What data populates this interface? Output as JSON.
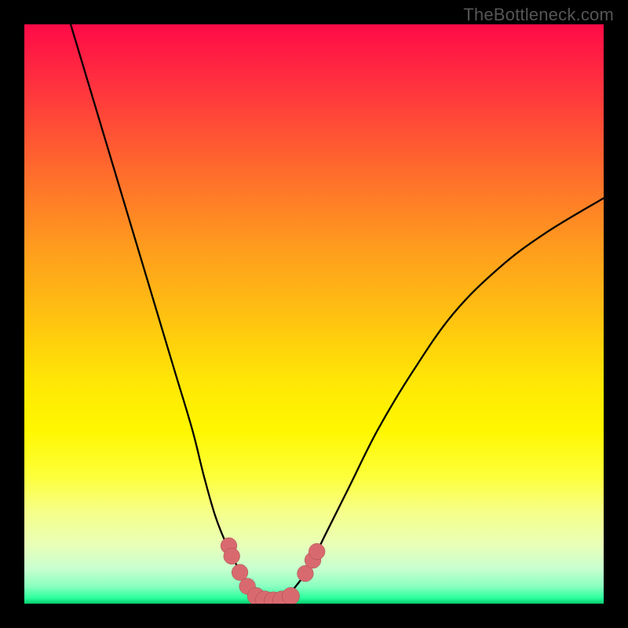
{
  "watermark": "TheBottleneck.com",
  "colors": {
    "background": "#000000",
    "curve_stroke": "#000000",
    "marker_fill": "#d86a6f",
    "marker_stroke": "#a04a4c"
  },
  "chart_data": {
    "type": "line",
    "title": "",
    "xlabel": "",
    "ylabel": "",
    "xlim": [
      0,
      100
    ],
    "ylim": [
      0,
      100
    ],
    "grid": false,
    "legend": null,
    "series": [
      {
        "name": "left-curve",
        "x": [
          8,
          11,
          14,
          17,
          20,
          23,
          26,
          29,
          31,
          33,
          35,
          37,
          39,
          40.5,
          42
        ],
        "values": [
          100,
          90,
          80,
          70,
          60,
          50,
          40,
          30,
          22,
          15,
          10,
          6,
          3,
          1.2,
          0.4
        ]
      },
      {
        "name": "right-curve",
        "x": [
          44,
          46,
          49,
          52,
          56,
          61,
          67,
          74,
          82,
          90,
          100
        ],
        "values": [
          0.4,
          2,
          6,
          12,
          20,
          30,
          40,
          50,
          58,
          64,
          70
        ]
      },
      {
        "name": "floor",
        "x": [
          42,
          43,
          44
        ],
        "values": [
          0.4,
          0.3,
          0.4
        ]
      }
    ],
    "markers": [
      {
        "x": 35.3,
        "y": 10.0,
        "r": 1.4
      },
      {
        "x": 35.8,
        "y": 8.2,
        "r": 1.4
      },
      {
        "x": 37.2,
        "y": 5.4,
        "r": 1.4
      },
      {
        "x": 38.5,
        "y": 3.0,
        "r": 1.4
      },
      {
        "x": 40.0,
        "y": 1.3,
        "r": 1.5
      },
      {
        "x": 41.5,
        "y": 0.6,
        "r": 1.6
      },
      {
        "x": 43.0,
        "y": 0.45,
        "r": 1.6
      },
      {
        "x": 44.5,
        "y": 0.6,
        "r": 1.6
      },
      {
        "x": 46.0,
        "y": 1.3,
        "r": 1.5
      },
      {
        "x": 48.5,
        "y": 5.2,
        "r": 1.4
      },
      {
        "x": 49.8,
        "y": 7.5,
        "r": 1.4
      },
      {
        "x": 50.5,
        "y": 9.0,
        "r": 1.4
      }
    ]
  }
}
